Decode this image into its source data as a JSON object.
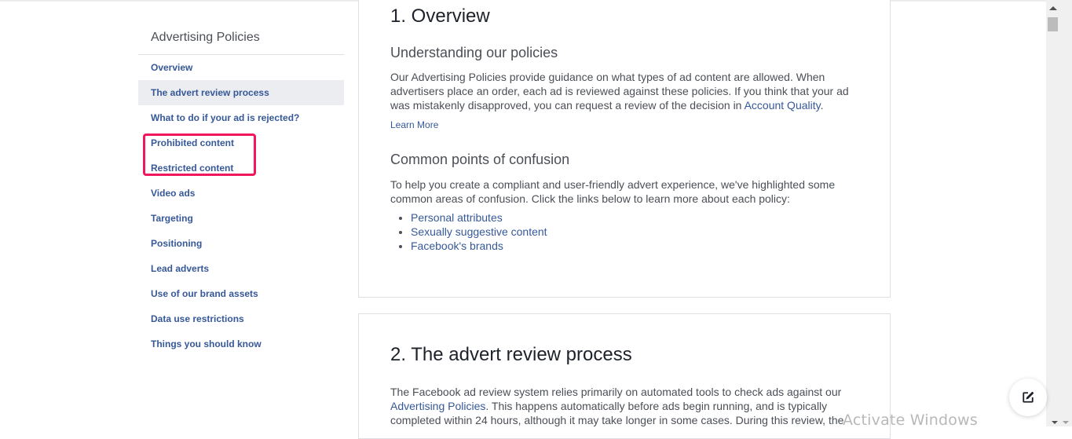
{
  "sidebar": {
    "title": "Advertising Policies",
    "items": [
      {
        "label": "Overview"
      },
      {
        "label": "The advert review process",
        "active": true
      },
      {
        "label": "What to do if your ad is rejected?"
      },
      {
        "label": "Prohibited content"
      },
      {
        "label": "Restricted content"
      },
      {
        "label": "Video ads"
      },
      {
        "label": "Targeting"
      },
      {
        "label": "Positioning"
      },
      {
        "label": "Lead adverts"
      },
      {
        "label": "Use of our brand assets"
      },
      {
        "label": "Data use restrictions"
      },
      {
        "label": "Things you should know"
      }
    ],
    "highlight_color": "#f0175c"
  },
  "overview": {
    "title": "1. Overview",
    "understanding": {
      "heading": "Understanding our policies",
      "text_before_link": "Our Advertising Policies provide guidance on what types of ad content are allowed. When advertisers place an order, each ad is reviewed against these policies. If you think that your ad was mistakenly disapproved, you can request a review of the decision in ",
      "link": "Account Quality",
      "text_after_link": ".",
      "learn_more": "Learn More"
    },
    "confusion": {
      "heading": "Common points of confusion",
      "text": "To help you create a compliant and user-friendly advert experience, we've highlighted some common areas of confusion. Click the links below to learn more about each policy:",
      "links": [
        "Personal attributes",
        "Sexually suggestive content",
        "Facebook's brands"
      ]
    }
  },
  "review_process": {
    "title": "2. The advert review process",
    "text_before_link": "The Facebook ad review system relies primarily on automated tools to check ads against our ",
    "link": "Advertising Policies",
    "text_after_link": ". This happens automatically before ads begin running, and is typically completed within 24 hours, although it may take longer in some cases. During this review, the"
  },
  "fab": {
    "icon": "edit-icon"
  },
  "watermark": "Activate Windows",
  "colors": {
    "link": "#365899",
    "text": "#4b4f56",
    "heading": "#1d2129",
    "active_bg": "#ebedf0"
  }
}
